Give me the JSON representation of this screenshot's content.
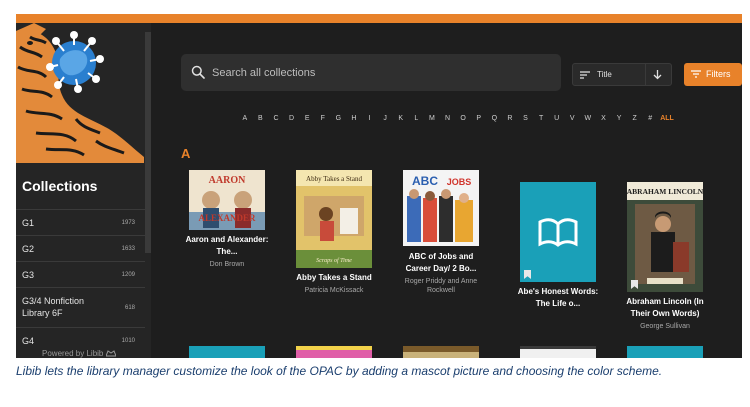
{
  "sidebar": {
    "collections_title": "Collections",
    "items": [
      {
        "label": "G1",
        "count": "1973"
      },
      {
        "label": "G2",
        "count": "1633"
      },
      {
        "label": "G3",
        "count": "1209"
      },
      {
        "label": "G3/4 Nonfiction",
        "label2": "Library 6F",
        "count": "618"
      },
      {
        "label": "G4",
        "count": "1010"
      }
    ],
    "powered_by": "Powered by Libib"
  },
  "search": {
    "placeholder": "Search all collections"
  },
  "sort": {
    "label": "Title"
  },
  "filters": {
    "label": "Filters"
  },
  "alphabet": [
    "A",
    "B",
    "C",
    "D",
    "E",
    "F",
    "G",
    "H",
    "I",
    "J",
    "K",
    "L",
    "M",
    "N",
    "O",
    "P",
    "Q",
    "R",
    "S",
    "T",
    "U",
    "V",
    "W",
    "X",
    "Y",
    "Z",
    "#",
    "ALL"
  ],
  "active_letter": "ALL",
  "section_letter": "A",
  "books": [
    {
      "title": "Aaron and Alexander: The...",
      "author": "Don Brown",
      "cover_text": "AARON ALEXANDER"
    },
    {
      "title": "Abby Takes a Stand",
      "author": "Patricia McKissack",
      "cover_text": "Abby Takes a Stand"
    },
    {
      "title": "ABC of Jobs and Career Day/ 2 Bo...",
      "author": "Roger Priddy and Anne Rockwell",
      "cover_text": "ABC JOBS"
    },
    {
      "title": "Abe's Honest Words: The Life o...",
      "author": ""
    },
    {
      "title": "Abraham Lincoln (In Their Own Words)",
      "author": "George Sullivan",
      "cover_text": "ABRAHAM LINCOLN"
    }
  ],
  "caption": "Libib lets the library manager customize the look of the OPAC by adding a mascot picture and choosing the color scheme.",
  "colors": {
    "accent": "#e8822a",
    "background": "#1e1e1e",
    "sidebar": "#252525",
    "teal": "#1aa0b8"
  }
}
